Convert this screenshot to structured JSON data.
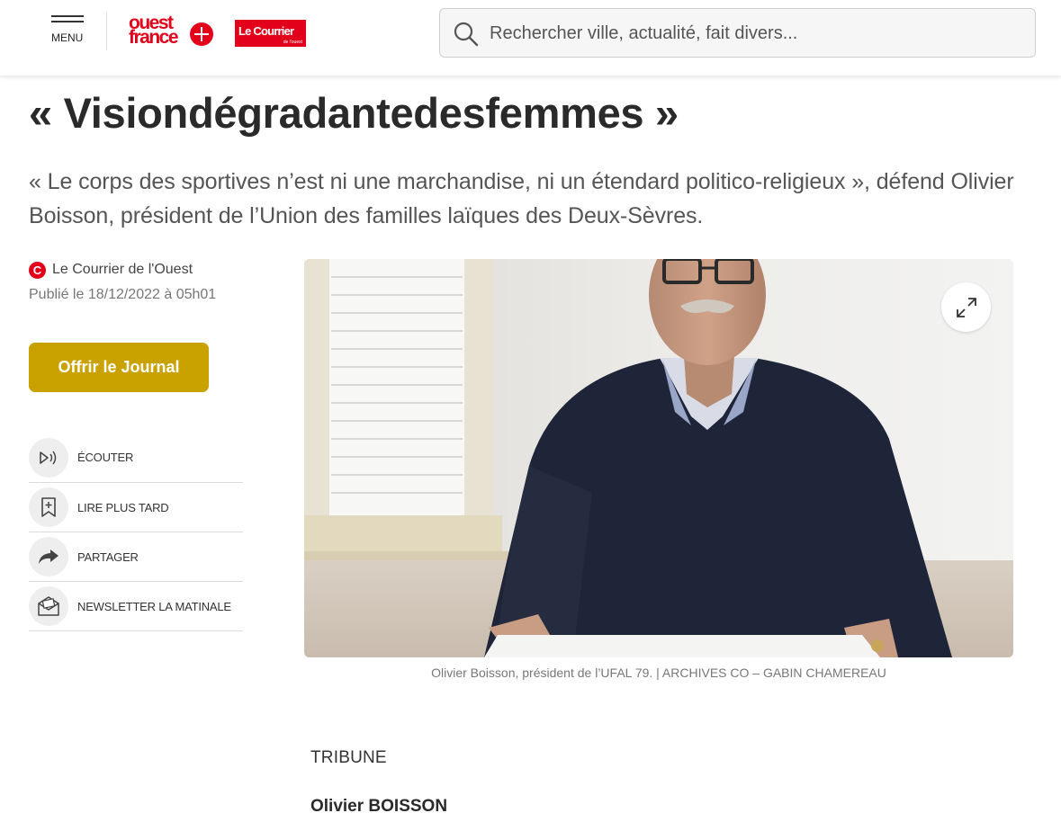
{
  "header": {
    "menu_label": "MENU",
    "logo_ouest_line1": "ouest",
    "logo_ouest_line2": "france",
    "logo_courrier_main": "Le Courrier",
    "logo_courrier_sub": "de l'ouest",
    "search_placeholder": "Rechercher ville, actualité, fait divers..."
  },
  "article": {
    "title": "« Visiondégradantedesfemmes »",
    "lead": "« Le corps des sportives n’est ni une marchandise, ni un étendard politico-religieux », défend Olivier Boisson, président de l’Union des familles laïques des Deux-Sèvres.",
    "source_initial": "C",
    "source": "Le Courrier de l'Ouest",
    "published": "Publié le 18/12/2022 à 05h01",
    "offer_button": "Offrir le Journal",
    "actions": [
      {
        "label": "ÉCOUTER",
        "icon": "speaker-icon"
      },
      {
        "label": "LIRE PLUS TARD",
        "icon": "bookmark-icon"
      },
      {
        "label": "PARTAGER",
        "icon": "share-icon"
      },
      {
        "label": "NEWSLETTER LA MATINALE",
        "icon": "newsletter-icon"
      }
    ],
    "photo_caption": "Olivier Boisson, président de l’UFAL 79. | ARCHIVES CO – GABIN CHAMEREAU",
    "section_tag": "TRIBUNE",
    "author": "Olivier BOISSON"
  },
  "colors": {
    "brand_red": "#e2001a",
    "offer_gold": "#c9a200"
  }
}
